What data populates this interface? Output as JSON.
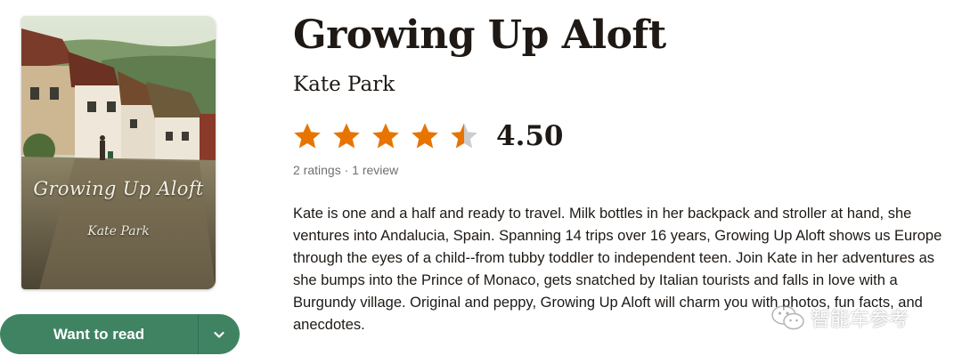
{
  "book": {
    "title": "Growing Up Aloft",
    "author": "Kate Park",
    "rating": 4.5,
    "rating_text": "4.50",
    "ratings_count": "2 ratings",
    "separator": "·",
    "reviews_count": "1 review",
    "description": "Kate is one and a half and ready to travel. Milk bottles in her backpack and stroller at hand, she ventures into Andalucia, Spain. Spanning 14 trips over 16 years, Growing Up Aloft shows us Europe through the eyes of a child--from tubby toddler to independent teen. Join Kate in her adventures as she bumps into the Prince of Monaco, gets snatched by Italian tourists and falls in love with a Burgundy village. Original and peppy, Growing Up Aloft will charm you with photos, fun facts, and anecdotes."
  },
  "cover": {
    "title": "Growing Up Aloft",
    "author": "Kate Park"
  },
  "actions": {
    "want_to_read_label": "Want to read",
    "dropdown_icon": "chevron-down-icon"
  },
  "watermark": {
    "text": "智能车参考",
    "icon": "wechat-icon"
  },
  "colors": {
    "star": "#e87400",
    "star_empty": "#cccccc",
    "button": "#3f8363",
    "text": "#1e1915",
    "muted": "#707070"
  }
}
